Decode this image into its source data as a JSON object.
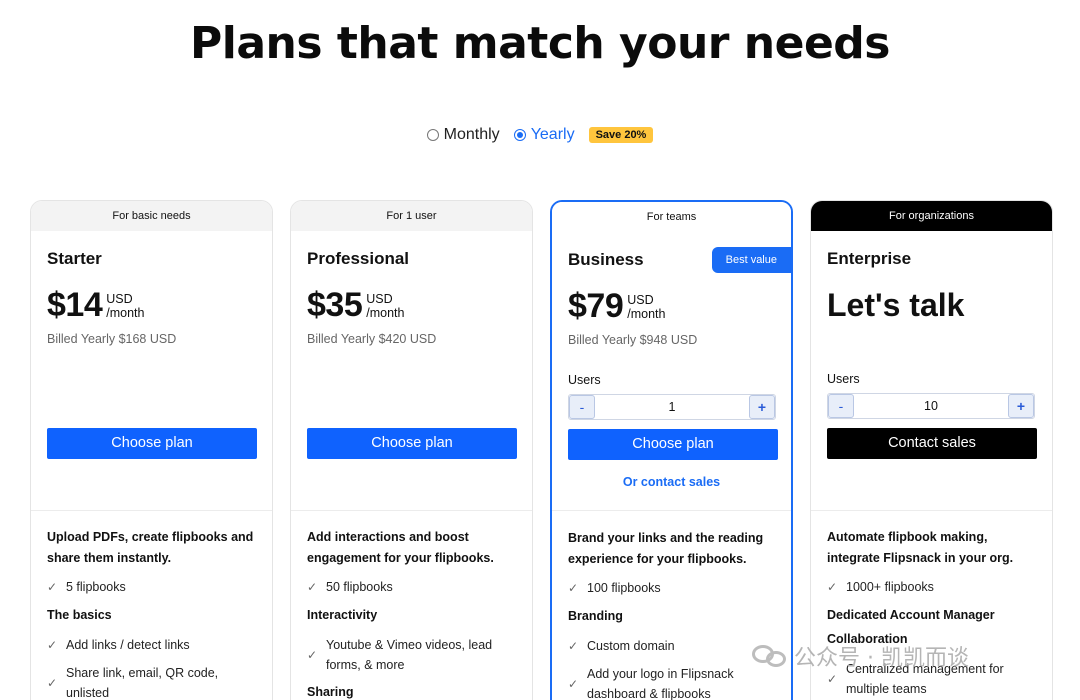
{
  "title": "Plans that match your needs",
  "billing": {
    "monthly_label": "Monthly",
    "yearly_label": "Yearly",
    "selected": "yearly",
    "save_badge": "Save 20%"
  },
  "plans": [
    {
      "header": "For basic needs",
      "name": "Starter",
      "price": "$14",
      "currency": "USD",
      "period": "/month",
      "billed": "Billed Yearly $168 USD",
      "cta": "Choose plan",
      "description": "Upload PDFs, create flipbooks and share them instantly.",
      "features": [
        {
          "type": "item",
          "text": "5 flipbooks"
        },
        {
          "type": "heading",
          "text": "The basics"
        },
        {
          "type": "item",
          "text": "Add links / detect links"
        },
        {
          "type": "item",
          "text": "Share link, email, QR code, unlisted"
        }
      ]
    },
    {
      "header": "For 1 user",
      "name": "Professional",
      "price": "$35",
      "currency": "USD",
      "period": "/month",
      "billed": "Billed Yearly $420 USD",
      "cta": "Choose plan",
      "description": "Add interactions and boost engagement for your flipbooks.",
      "features": [
        {
          "type": "item",
          "text": "50 flipbooks"
        },
        {
          "type": "heading",
          "text": "Interactivity"
        },
        {
          "type": "item",
          "text": "Youtube & Vimeo videos, lead forms, & more"
        },
        {
          "type": "heading",
          "text": "Sharing"
        }
      ]
    },
    {
      "header": "For teams",
      "name": "Business",
      "badge": "Best value",
      "price": "$79",
      "currency": "USD",
      "period": "/month",
      "billed": "Billed Yearly $948 USD",
      "users_label": "Users",
      "users_value": "1",
      "minus": "-",
      "plus": "+",
      "cta": "Choose plan",
      "secondary_link": "Or contact sales",
      "description": "Brand your links and the reading experience for your flipbooks.",
      "features": [
        {
          "type": "item",
          "text": "100 flipbooks"
        },
        {
          "type": "heading",
          "text": "Branding"
        },
        {
          "type": "item",
          "text": "Custom domain"
        },
        {
          "type": "item",
          "text": "Add your logo in Flipsnack dashboard & flipbooks"
        }
      ]
    },
    {
      "header": "For organizations",
      "name": "Enterprise",
      "headline": "Let's talk",
      "users_label": "Users",
      "users_value": "10",
      "minus": "-",
      "plus": "+",
      "cta": "Contact sales",
      "description": "Automate flipbook making, integrate Flipsnack in your org.",
      "features": [
        {
          "type": "item",
          "text": "1000+ flipbooks"
        },
        {
          "type": "heading",
          "text": "Dedicated Account Manager"
        },
        {
          "type": "heading",
          "text": "Collaboration"
        },
        {
          "type": "item",
          "text": "Centralized management for multiple teams"
        }
      ]
    }
  ],
  "watermark": "公众号 · 凯凯而谈",
  "colors": {
    "accent": "#1a6cf5",
    "cta": "#0f62fe",
    "badge": "#ffc53d",
    "dark": "#000000"
  }
}
